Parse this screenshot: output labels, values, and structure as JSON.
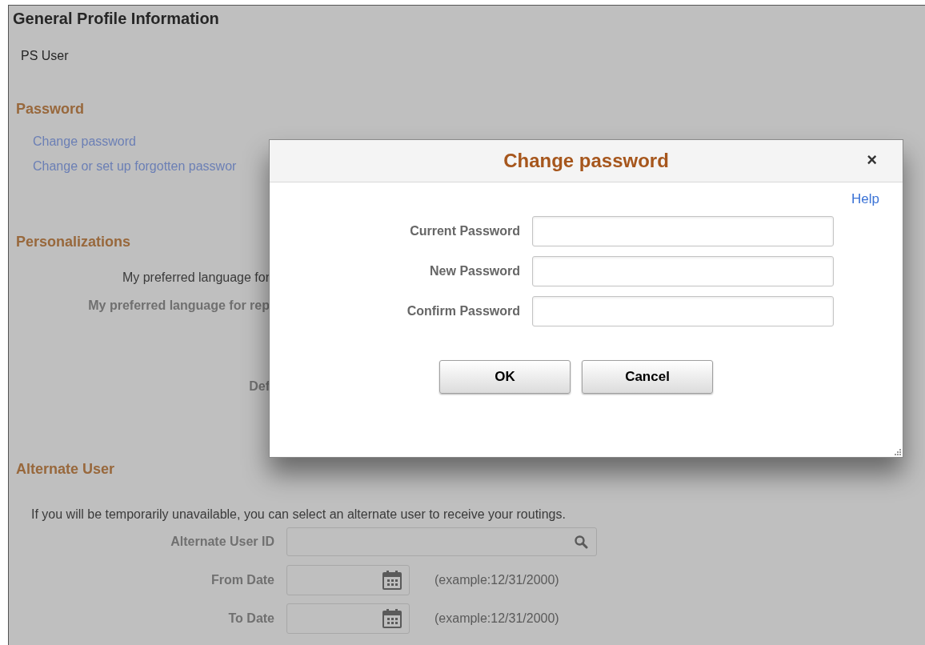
{
  "page": {
    "title": "General Profile Information",
    "user": "PS User",
    "password_section": {
      "heading": "Password",
      "links": [
        "Change password",
        "Change or set up forgotten passwor"
      ]
    },
    "personalizations": {
      "heading": "Personalizations",
      "labels": [
        {
          "text": "My preferred language for",
          "bold": false
        },
        {
          "text": "My preferred language for rep",
          "bold": true
        },
        {
          "text": "Def",
          "bold": true
        }
      ]
    },
    "alternate_user": {
      "heading": "Alternate User",
      "note": "If you will be temporarily unavailable, you can select an alternate user to receive your routings.",
      "fields": [
        {
          "label": "Alternate User ID",
          "kind": "lookup"
        },
        {
          "label": "From Date",
          "kind": "date",
          "hint": "(example:12/31/2000)"
        },
        {
          "label": "To Date",
          "kind": "date",
          "hint": "(example:12/31/2000)"
        }
      ]
    }
  },
  "dialog": {
    "title": "Change password",
    "close": "×",
    "help": "Help",
    "fields": [
      {
        "label": "Current Password"
      },
      {
        "label": "New Password"
      },
      {
        "label": "Confirm Password"
      }
    ],
    "buttons": [
      "OK",
      "Cancel"
    ]
  }
}
